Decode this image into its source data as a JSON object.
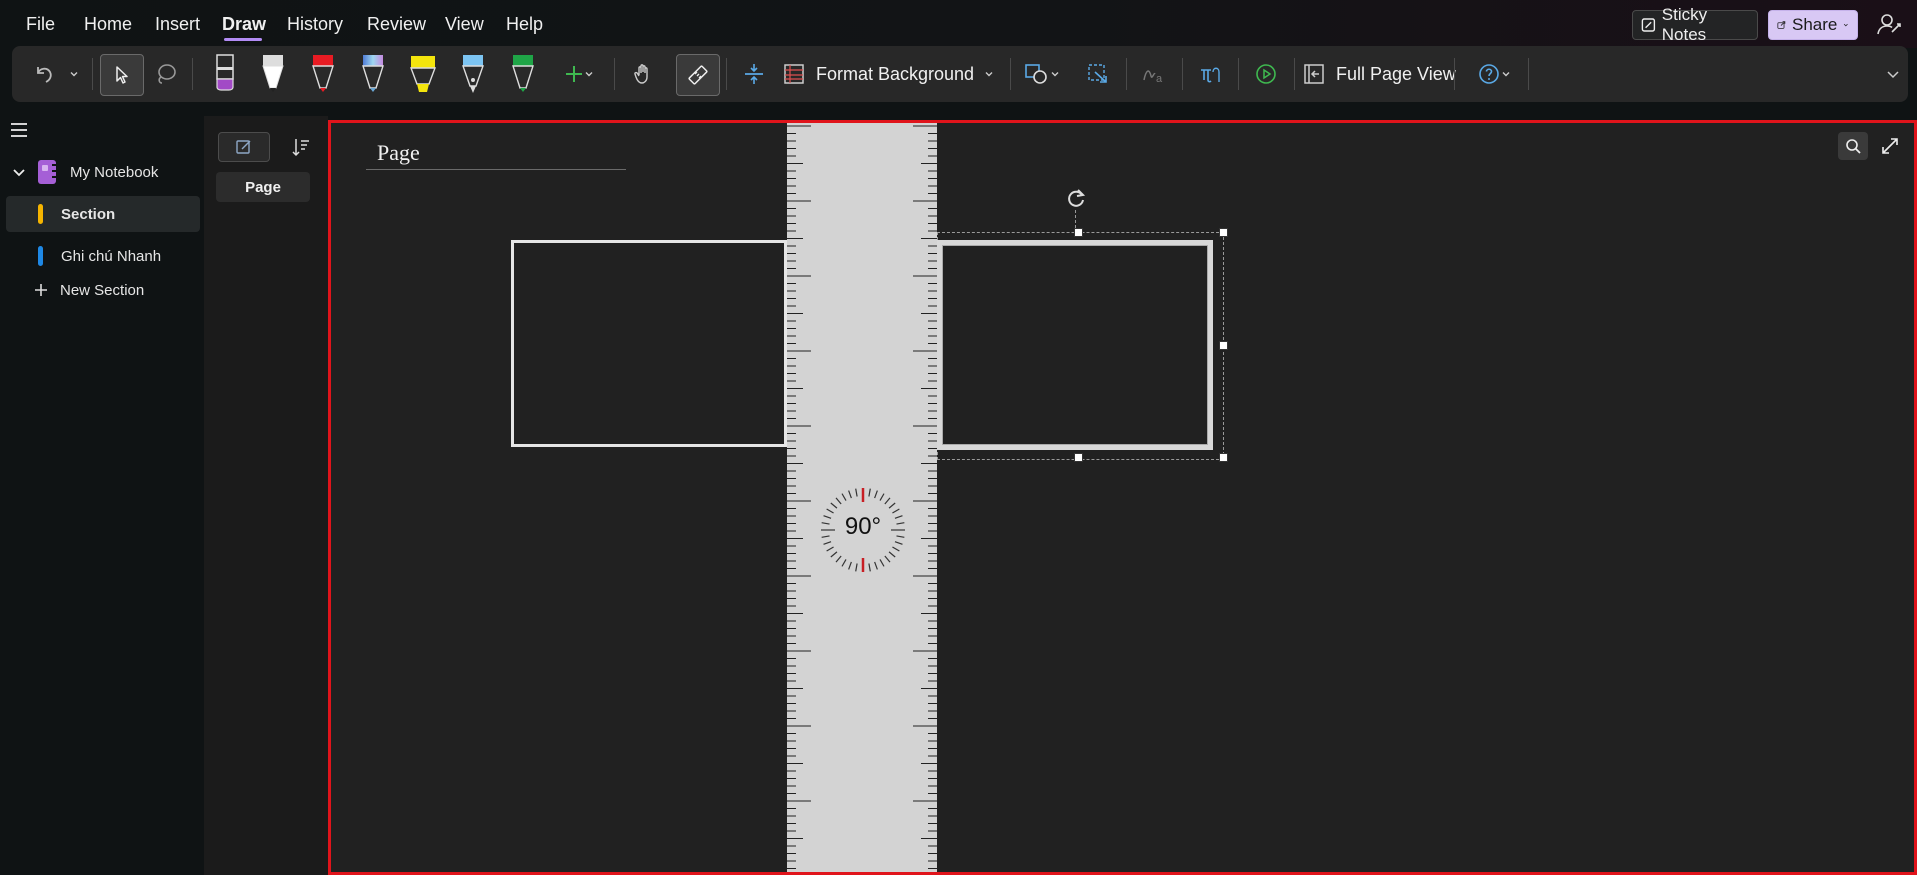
{
  "menubar": {
    "items": [
      "File",
      "Home",
      "Insert",
      "Draw",
      "History",
      "Review",
      "View",
      "Help"
    ],
    "active": "Draw",
    "sticky_notes_label": "Sticky Notes",
    "share_label": "Share"
  },
  "ribbon": {
    "format_background_label": "Format Background",
    "full_page_view_label": "Full Page View",
    "pens": [
      {
        "name": "pen-purple",
        "color": "#a24ac6"
      },
      {
        "name": "pen-white",
        "color": "#ffffff"
      },
      {
        "name": "pen-red",
        "color": "#e81b23"
      },
      {
        "name": "pen-galaxy",
        "color": "#6aa7d6"
      },
      {
        "name": "highlighter-yellow",
        "color": "#f4e50d"
      },
      {
        "name": "pen-blue",
        "color": "#7cc4f2"
      },
      {
        "name": "pen-green",
        "color": "#1fa547"
      }
    ]
  },
  "nav": {
    "notebook_name": "My Notebook",
    "sections": [
      {
        "label": "Section",
        "color": "#f5b400",
        "selected": true
      },
      {
        "label": "Ghi chú Nhanh",
        "color": "#1e88e5",
        "selected": false
      }
    ],
    "new_section_label": "New Section"
  },
  "pagelist": {
    "pages": [
      "Page"
    ]
  },
  "canvas": {
    "page_title": "Page",
    "ruler_angle": "90°"
  },
  "colors": {
    "accent": "#b38cf5",
    "canvas_border": "#e0141b",
    "canvas_bg": "#212121",
    "ruler_bg": "#d3d3d3"
  }
}
